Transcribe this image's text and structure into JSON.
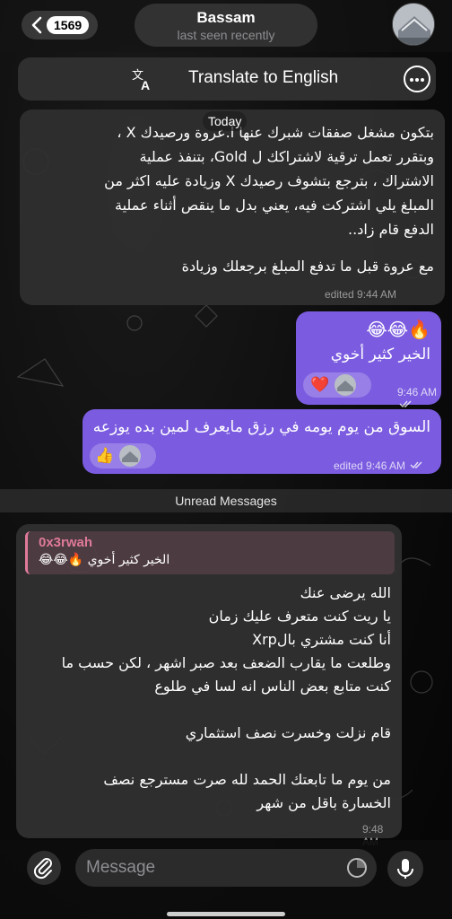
{
  "header": {
    "back_count": "1569",
    "contact_name": "Bassam",
    "status": "last seen recently"
  },
  "translate": {
    "label": "Translate to English"
  },
  "date_pill": "Today",
  "messages": {
    "m1": {
      "lines": [
        "بتكون مشغل صفقات شبرك عنها أ.عروة ورصيدك X ،",
        "وبتقرر تعمل ترقية لاشتراكك ل Gold، بتنفذ عملية",
        "الاشتراك ، بترجع بتشوف رصيدك X وزيادة عليه اكثر من",
        "المبلغ يلي اشتركت فيه، يعني بدل ما ينقص أثناء عملية",
        "الدفع قام زاد..",
        "",
        "مع عروة قبل ما تدفع المبلغ برجعلك وزيادة"
      ],
      "meta": "edited 9:44 AM"
    },
    "m2": {
      "emoji": "😂😂🔥",
      "text": "الخير كثير أخوي",
      "reaction": "❤️",
      "time": "9:46 AM"
    },
    "m3": {
      "text": "السوق من يوم يومه في رزق مايعرف لمين بده يوزعه",
      "reaction": "👍",
      "meta": "edited 9:46 AM"
    },
    "m4": {
      "reply_author": "0x3rwah",
      "reply_text": "الخير كثير أخوي 🔥😂😂",
      "lines": [
        "الله يرضى عنك",
        "يا ريت كنت متعرف عليك زمان",
        "أنا كنت مشتري بالXrp",
        "وطلعت ما يقارب الضعف بعد صبر اشهر ، لكن حسب ما",
        "كنت متابع بعض الناس انه لسا في طلوع",
        "",
        "قام نزلت وخسرت نصف استثماري",
        "",
        "من يوم ما تابعتك الحمد لله صرت مسترجع نصف",
        "الخسارة باقل من شهر"
      ],
      "time": "9:48 AM"
    }
  },
  "unread_label": "Unread Messages",
  "input": {
    "placeholder": "Message"
  },
  "colors": {
    "outgoing_bubble": "#7b5ce0",
    "reply_accent": "#e07a9a"
  }
}
